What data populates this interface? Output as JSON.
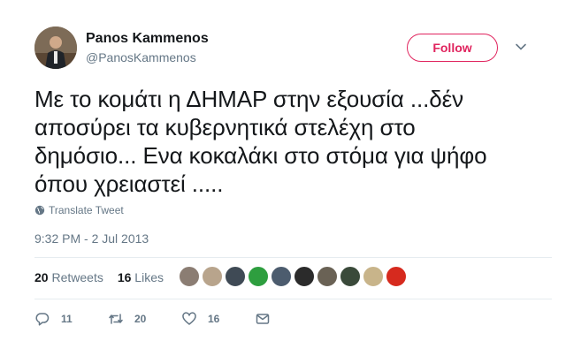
{
  "user": {
    "name": "Panos Kammenos",
    "handle": "@PanosKammenos"
  },
  "follow_label": "Follow",
  "tweet": {
    "lines": [
      "Με το κομάτι η ΔΗΜΑΡ στην εξουσία ...δέν",
      "αποσύρει τα κυβερνητικά στελέχη στο",
      "δημόσιο... Ενα κοκαλάκι στο στόμα για ψήφο",
      "όπου χρειαστεί ....."
    ],
    "translate_label": "Translate Tweet",
    "timestamp": "9:32 PM - 2 Jul 2013"
  },
  "stats": {
    "retweets_count": "20",
    "retweets_label": "Retweets",
    "likes_count": "16",
    "likes_label": "Likes"
  },
  "liker_avatar_colors": [
    "#8b7d73",
    "#b8a48c",
    "#3f4a55",
    "#2e9e3f",
    "#4c5c6e",
    "#2b2b2b",
    "#6a6255",
    "#3a4a3a",
    "#c8b48a",
    "#d62a1e"
  ],
  "actions": {
    "replies": "11",
    "retweets": "20",
    "likes": "16"
  },
  "colors": {
    "follow": "#e0245e",
    "muted": "#657786",
    "text": "#14171a"
  }
}
